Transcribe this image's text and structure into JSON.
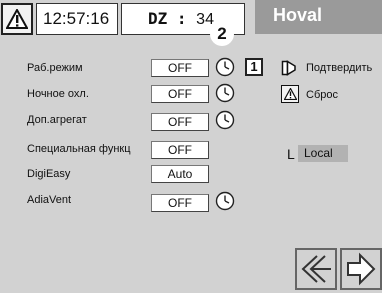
{
  "header": {
    "time": "12:57:16",
    "dz_label": "DZ :",
    "dz_value": "34",
    "brand": "Hoval"
  },
  "marker": "2",
  "one_label": "1",
  "rows": [
    {
      "label": "Раб.режим",
      "value": "OFF",
      "clock": true
    },
    {
      "label": "Ночное охл.",
      "value": "OFF",
      "clock": true
    },
    {
      "label": "Доп.агрегат",
      "value": "OFF",
      "clock": true
    },
    {
      "label": "Специальная функц",
      "value": "OFF",
      "clock": false
    },
    {
      "label": "DigiEasy",
      "value": "Auto",
      "clock": false
    },
    {
      "label": "AdiaVent",
      "value": "OFF",
      "clock": true
    }
  ],
  "side": {
    "confirm_label": "Подтвердить",
    "reset_label": "Сброс",
    "local_prefix": "L",
    "local_value": "Local"
  },
  "icons": {
    "warning": "warning-triangle-icon",
    "clock": "clock-icon",
    "confirm": "confirm-flag-icon",
    "back": "double-left-arrow-icon",
    "next": "right-arrow-icon"
  }
}
